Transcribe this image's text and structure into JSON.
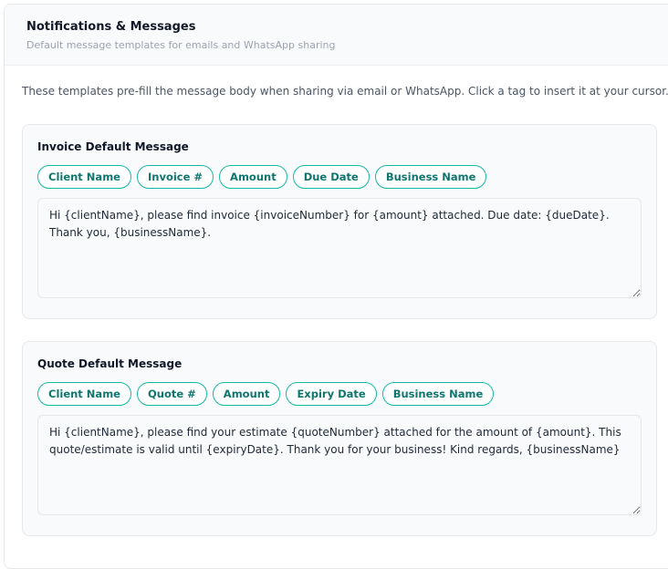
{
  "header": {
    "title": "Notifications & Messages",
    "subtitle": "Default message templates for emails and WhatsApp sharing"
  },
  "intro": "These templates pre-fill the message body when sharing via email or WhatsApp. Click a tag to insert it at your cursor.",
  "invoice": {
    "title": "Invoice Default Message",
    "tags": [
      "Client Name",
      "Invoice #",
      "Amount",
      "Due Date",
      "Business Name"
    ],
    "message": "Hi {clientName}, please find invoice {invoiceNumber} for {amount} attached. Due date: {dueDate}. Thank you, {businessName}."
  },
  "quote": {
    "title": "Quote Default Message",
    "tags": [
      "Client Name",
      "Quote #",
      "Amount",
      "Expiry Date",
      "Business Name"
    ],
    "message": "Hi {clientName}, please find your estimate {quoteNumber} attached for the amount of {amount}. This quote/estimate is valid until {expiryDate}. Thank you for your business! Kind regards, {businessName}"
  },
  "colors": {
    "accent": "#14b8a6",
    "accent_text": "#0f766e"
  }
}
